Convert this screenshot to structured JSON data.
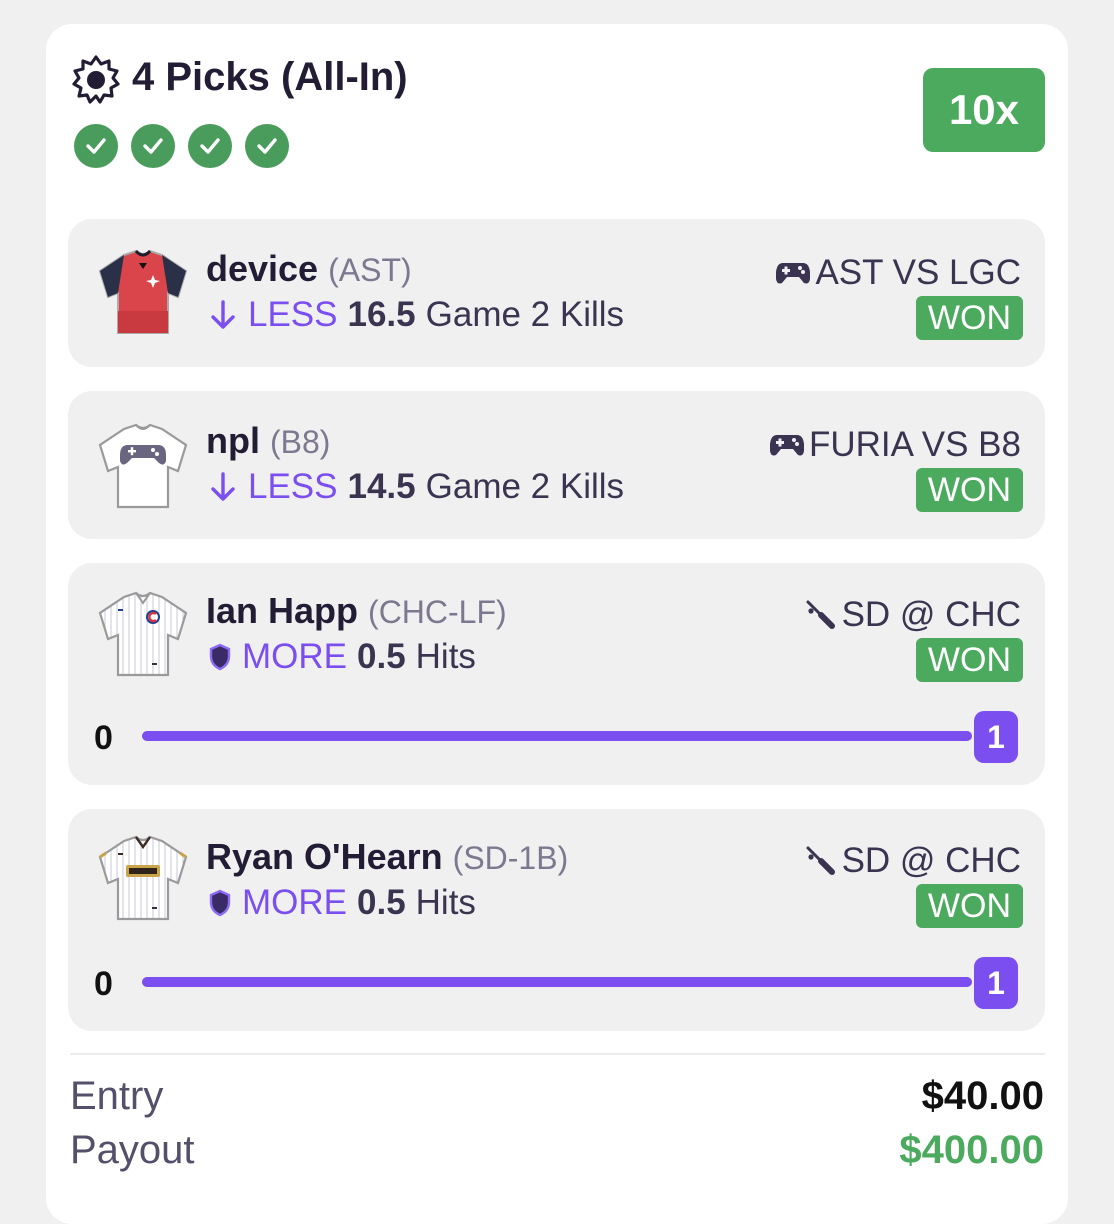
{
  "header": {
    "title": "4 Picks (All-In)",
    "multiplier": "10x",
    "checks": 4
  },
  "picks": [
    {
      "player": "device",
      "team": "(AST)",
      "direction": "LESS",
      "line": "16.5",
      "stat": "Game 2 Kills",
      "matchup": "AST VS LGC",
      "matchup_icon": "gamepad-icon",
      "result": "WON"
    },
    {
      "player": "npl",
      "team": "(B8)",
      "direction": "LESS",
      "line": "14.5",
      "stat": "Game 2 Kills",
      "matchup": "FURIA VS B8",
      "matchup_icon": "gamepad-icon",
      "result": "WON"
    },
    {
      "player": "Ian Happ",
      "team": "(CHC-LF)",
      "direction": "MORE",
      "line": "0.5",
      "stat": "Hits",
      "matchup": "SD @ CHC",
      "matchup_icon": "baseball-bat-icon",
      "result": "WON",
      "progress": {
        "min": "0",
        "current": "1",
        "fraction": 1.0
      }
    },
    {
      "player": "Ryan O'Hearn",
      "team": "(SD-1B)",
      "direction": "MORE",
      "line": "0.5",
      "stat": "Hits",
      "matchup": "SD @ CHC",
      "matchup_icon": "baseball-bat-icon",
      "result": "WON",
      "progress": {
        "min": "0",
        "current": "1",
        "fraction": 1.0
      }
    }
  ],
  "summary": {
    "entry_label": "Entry",
    "entry_value": "$40.00",
    "payout_label": "Payout",
    "payout_value": "$400.00"
  },
  "colors": {
    "accent_purple": "#7b4ef0",
    "won_green": "#4caa5e",
    "payout_green": "#4caa5e",
    "text_dark": "#221c35"
  }
}
